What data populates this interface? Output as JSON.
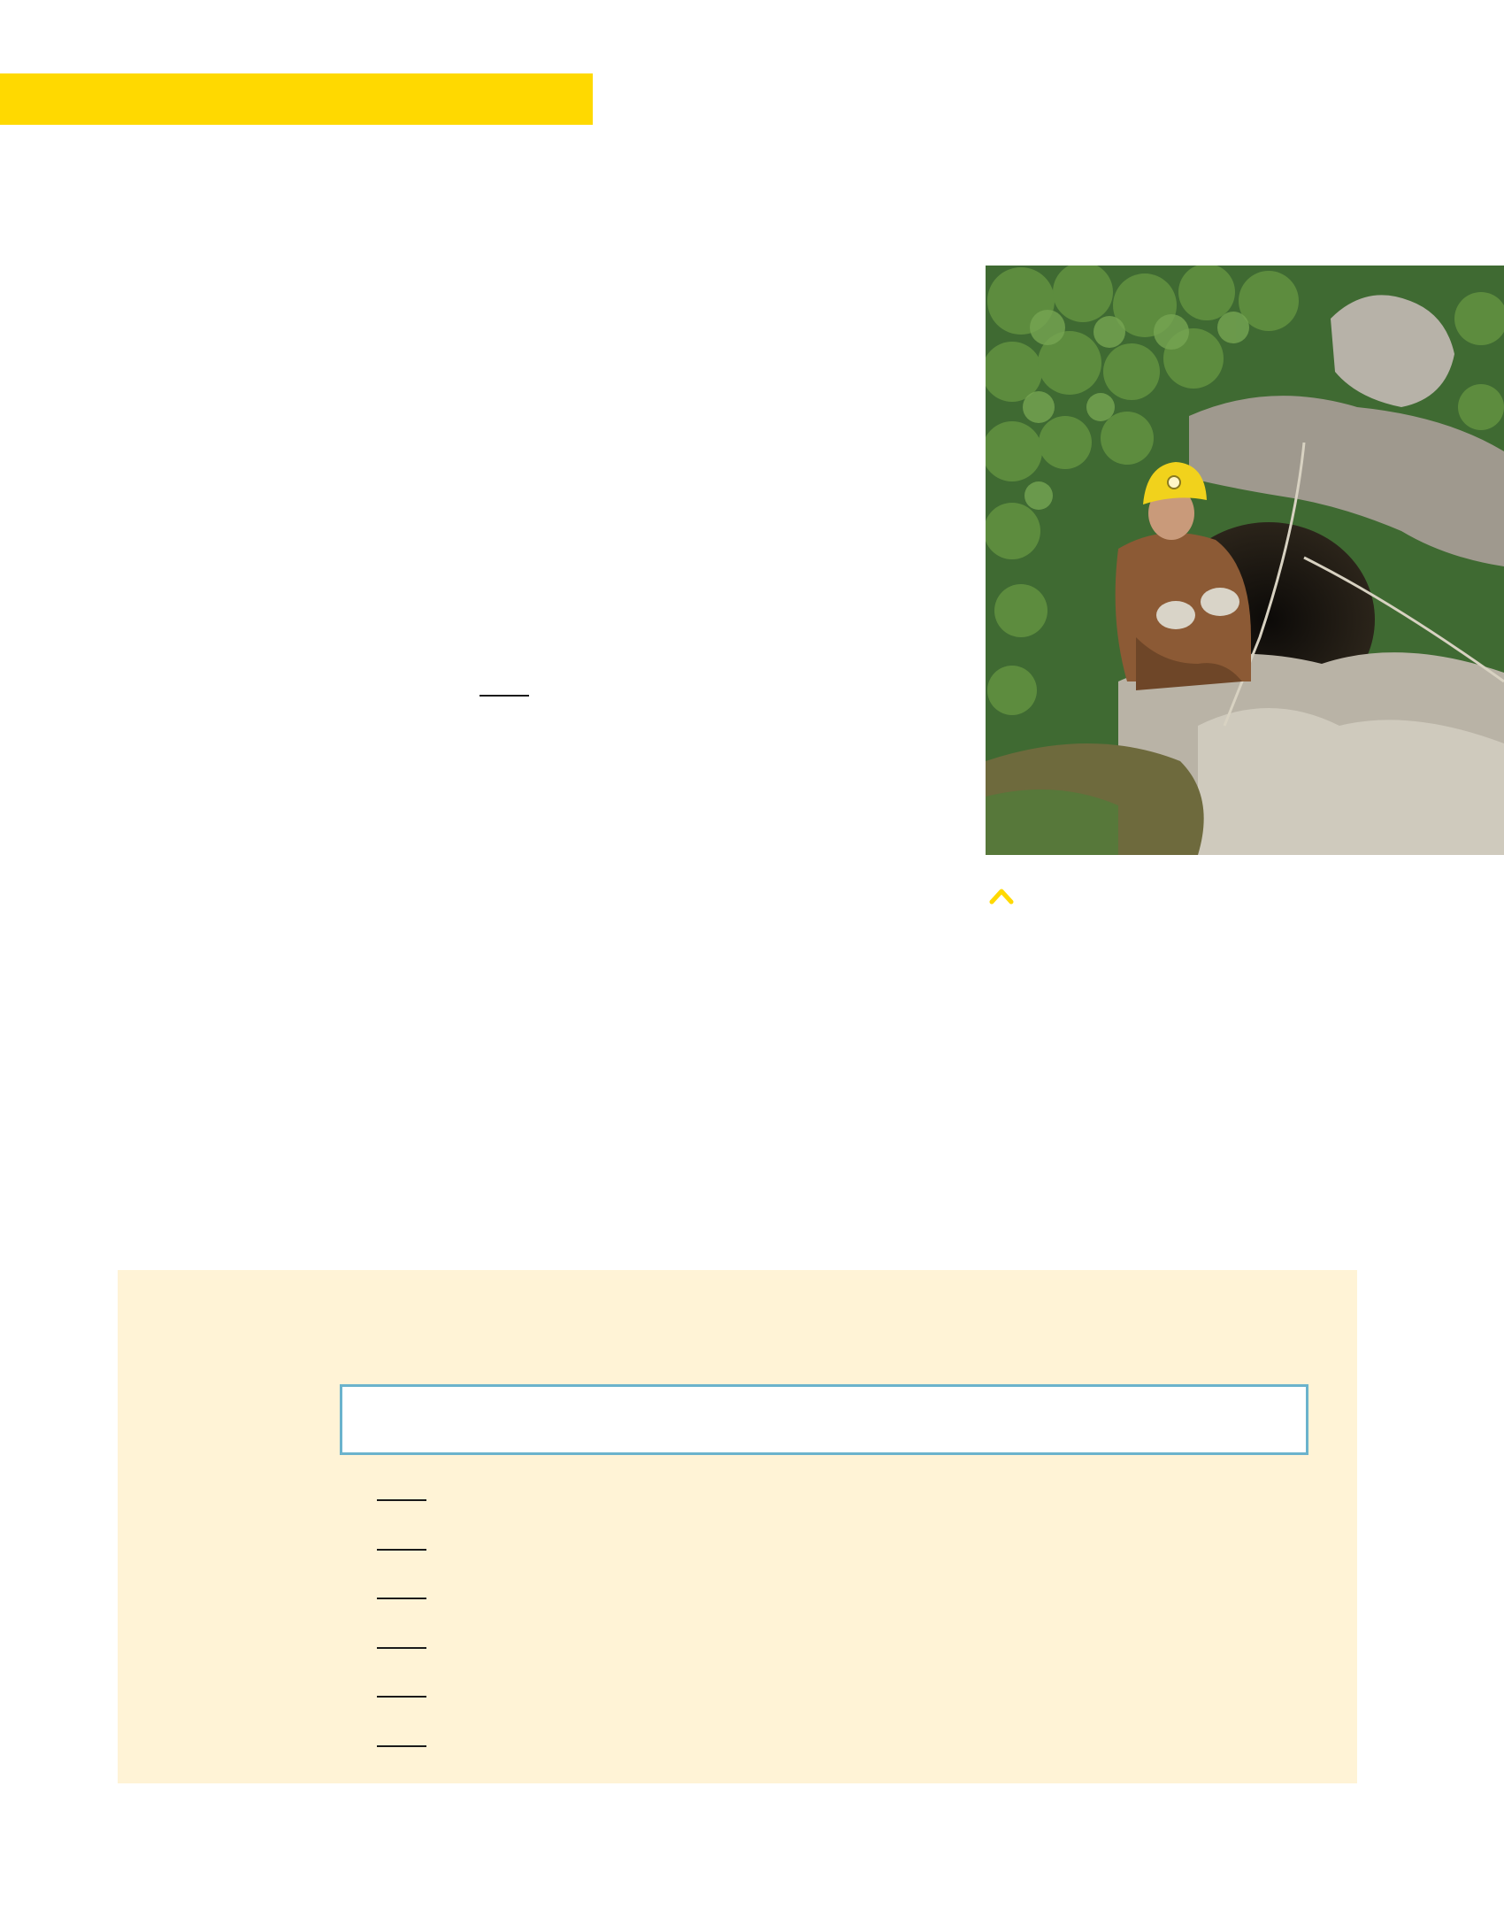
{
  "header": {
    "accent_color": "#ffd900"
  },
  "photo": {
    "subject": "caver-in-cave-entrance-photo"
  },
  "caption": {
    "marker_icon": "caret-up-icon",
    "marker_color": "#ffd900"
  },
  "activity": {
    "background_color": "#fff3d6",
    "answer_box_border_color": "#6bb3cc",
    "blank_count": 6
  }
}
